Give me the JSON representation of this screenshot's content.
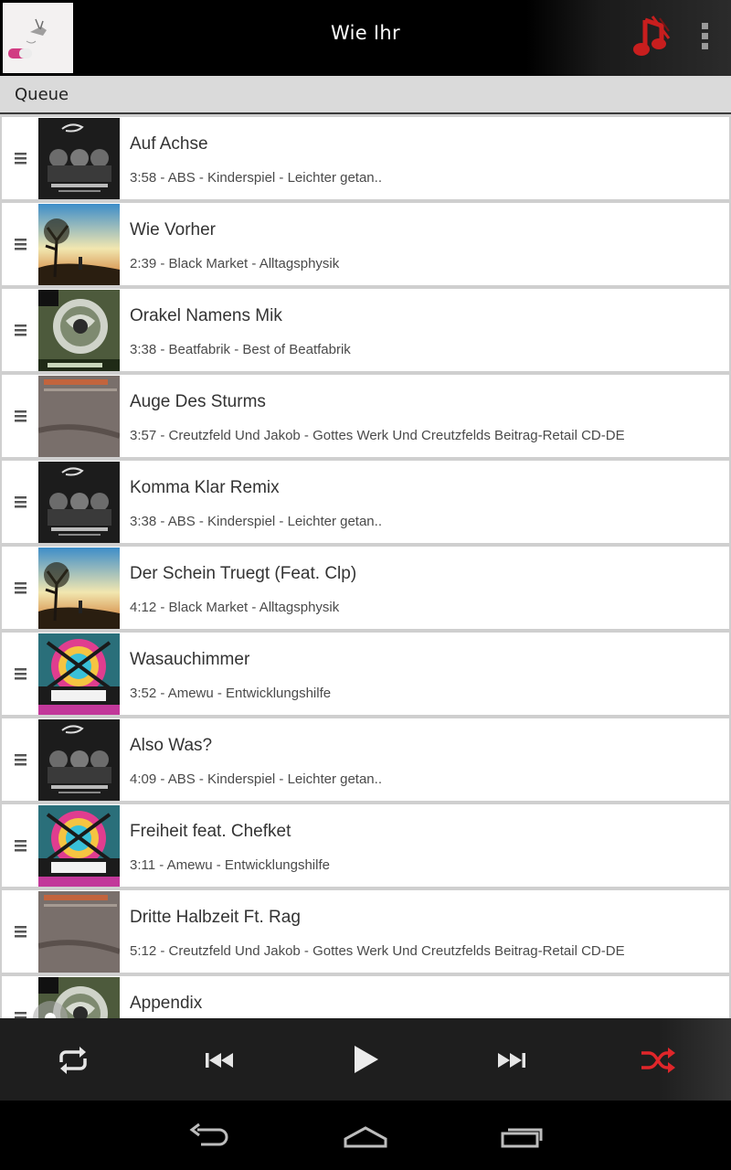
{
  "now_playing": {
    "title": "Wie Ihr"
  },
  "queue": {
    "label": "Queue",
    "items": [
      {
        "title": "Auf Achse",
        "meta": "3:58 - ABS - Kinderspiel - Leichter getan..",
        "cover": "abs"
      },
      {
        "title": "Wie Vorher",
        "meta": "2:39 - Black Market - Alltagsphysik",
        "cover": "blackmarket"
      },
      {
        "title": "Orakel Namens Mik",
        "meta": "3:38 - Beatfabrik - Best of Beatfabrik",
        "cover": "beatfabrik"
      },
      {
        "title": "Auge Des Sturms",
        "meta": "3:57 - Creutzfeld Und Jakob - Gottes Werk Und Creutzfelds Beitrag-Retail CD-DE",
        "cover": "creutzfeld"
      },
      {
        "title": "Komma Klar Remix",
        "meta": "3:38 - ABS - Kinderspiel - Leichter getan..",
        "cover": "abs"
      },
      {
        "title": "Der Schein Truegt (Feat. Clp)",
        "meta": "4:12 - Black Market - Alltagsphysik",
        "cover": "blackmarket"
      },
      {
        "title": "Wasauchimmer",
        "meta": "3:52 - Amewu - Entwicklungshilfe",
        "cover": "amewu"
      },
      {
        "title": "Also Was?",
        "meta": "4:09 - ABS - Kinderspiel - Leichter getan..",
        "cover": "abs"
      },
      {
        "title": "Freiheit feat. Chefket",
        "meta": "3:11 - Amewu - Entwicklungshilfe",
        "cover": "amewu"
      },
      {
        "title": "Dritte Halbzeit Ft. Rag",
        "meta": "5:12 - Creutzfeld Und Jakob - Gottes Werk Und Creutzfelds Beitrag-Retail CD-DE",
        "cover": "creutzfeld"
      },
      {
        "title": "Appendix",
        "meta": "",
        "cover": "beatfabrik"
      }
    ]
  },
  "icons": {
    "music": "music-note-icon",
    "overflow": "overflow-menu-icon",
    "repeat": "repeat-icon",
    "previous": "previous-icon",
    "play": "play-icon",
    "next": "next-icon",
    "shuffle": "shuffle-icon",
    "back": "back-icon",
    "home": "home-icon",
    "recents": "recents-icon",
    "drag": "drag-handle-icon"
  },
  "colors": {
    "accent": "#d42020",
    "shuffle_active": "#e0262a"
  }
}
